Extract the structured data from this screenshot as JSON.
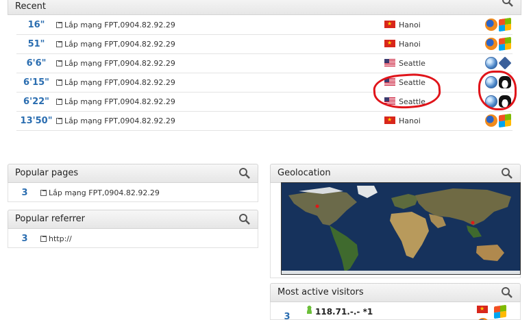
{
  "recent": {
    "title": "Recent",
    "rows": [
      {
        "time": "16\"",
        "page": "Lắp mạng FPT,0904.82.92.29",
        "city": "Hanoi",
        "flag": "vn",
        "icons": [
          "firefox-icon",
          "windows-icon"
        ]
      },
      {
        "time": "51\"",
        "page": "Lắp mạng FPT,0904.82.92.29",
        "city": "Hanoi",
        "flag": "vn",
        "icons": [
          "firefox-icon",
          "windows-icon"
        ]
      },
      {
        "time": "6'6\"",
        "page": "Lắp mạng FPT,0904.82.92.29",
        "city": "Seattle",
        "flag": "us",
        "icons": [
          "globe-icon",
          "diamond-icon"
        ]
      },
      {
        "time": "6'15\"",
        "page": "Lắp mạng FPT,0904.82.92.29",
        "city": "Seattle",
        "flag": "us",
        "icons": [
          "globe-icon",
          "tux-icon"
        ]
      },
      {
        "time": "6'22\"",
        "page": "Lắp mạng FPT,0904.82.92.29",
        "city": "Seattle",
        "flag": "us",
        "icons": [
          "globe-icon",
          "tux-icon"
        ]
      },
      {
        "time": "13'50\"",
        "page": "Lắp mạng FPT,0904.82.92.29",
        "city": "Hanoi",
        "flag": "vn",
        "icons": [
          "firefox-icon",
          "windows-icon"
        ]
      }
    ]
  },
  "popular_pages": {
    "title": "Popular pages",
    "count": "3",
    "page": "Lắp mạng FPT,0904.82.92.29"
  },
  "popular_referrer": {
    "title": "Popular referrer",
    "count": "3",
    "referrer": "http://"
  },
  "geolocation": {
    "title": "Geolocation"
  },
  "most_active": {
    "title": "Most active visitors",
    "count": "3",
    "ip": "118.71.-.- *1",
    "flag": "vn"
  },
  "colors": {
    "accent": "#2a6db0",
    "annotation": "#e0141a"
  }
}
